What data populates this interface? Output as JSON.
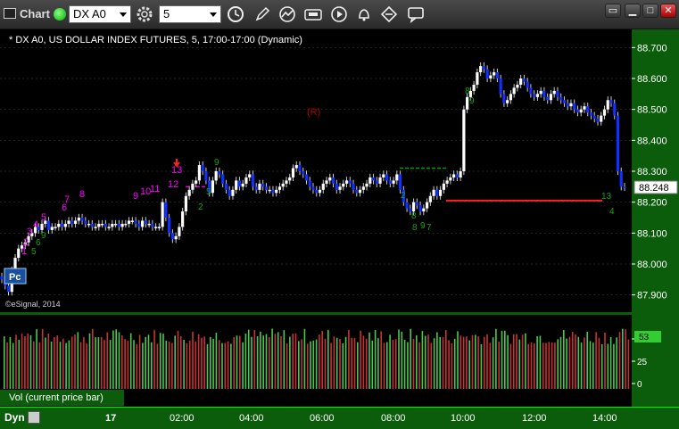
{
  "window": {
    "title": "Chart"
  },
  "toolbar": {
    "symbol_value": "DX A0",
    "interval_value": "5"
  },
  "chart": {
    "header_text": "* DX A0, US DOLLAR INDEX FUTURES, 5, 17:00-17:00 (Dynamic)",
    "copyright": "©eSignal, 2014",
    "annotation_r": "(R)",
    "pc_label": "Pc",
    "price_ticks": [
      "88.700",
      "88.600",
      "88.500",
      "88.400",
      "88.300",
      "88.200",
      "88.100",
      "88.000",
      "87.900"
    ],
    "last_price": "88.248",
    "seq_magenta": [
      "1",
      "2",
      "3",
      "4",
      "5",
      "6",
      "7",
      "8",
      "9",
      "10",
      "11",
      "12",
      "13"
    ],
    "seq_green_a": [
      "5",
      "6",
      "9"
    ],
    "seq_green_b": [
      "2",
      "5",
      "9"
    ],
    "seq_green_c": [
      "2",
      "8",
      "9",
      "8",
      "7"
    ],
    "seq_green_d": [
      "8",
      "9"
    ],
    "seq_green_e": [
      "13",
      "4"
    ]
  },
  "volume": {
    "title": "Vol (current price bar)",
    "ticks": [
      "50",
      "25",
      "0"
    ],
    "current_value": "53"
  },
  "timeaxis": {
    "mode_label": "Dyn",
    "labels": [
      "17",
      "02:00",
      "04:00",
      "06:00",
      "08:00",
      "10:00",
      "12:00",
      "14:00"
    ]
  },
  "chart_data": {
    "type": "candlestick",
    "symbol": "DX A0",
    "interval": "5",
    "ylim": [
      87.85,
      88.75
    ],
    "price_ticks": [
      88.7,
      88.6,
      88.5,
      88.4,
      88.3,
      88.2,
      88.1,
      88.0,
      87.9
    ],
    "last_price": 88.248,
    "close_series": [
      87.95,
      87.93,
      87.91,
      87.98,
      88.02,
      88.05,
      88.06,
      88.07,
      88.09,
      88.1,
      88.12,
      88.11,
      88.13,
      88.14,
      88.11,
      88.12,
      88.12,
      88.13,
      88.12,
      88.13,
      88.14,
      88.13,
      88.14,
      88.15,
      88.14,
      88.13,
      88.13,
      88.12,
      88.12,
      88.13,
      88.13,
      88.12,
      88.12,
      88.13,
      88.13,
      88.12,
      88.13,
      88.13,
      88.14,
      88.14,
      88.13,
      88.12,
      88.14,
      88.13,
      88.13,
      88.12,
      88.12,
      88.12,
      88.2,
      88.15,
      88.1,
      88.08,
      88.09,
      88.12,
      88.17,
      88.22,
      88.24,
      88.26,
      88.27,
      88.32,
      88.3,
      88.27,
      88.23,
      88.27,
      88.3,
      88.29,
      88.26,
      88.24,
      88.22,
      88.24,
      88.27,
      88.25,
      88.26,
      88.28,
      88.29,
      88.25,
      88.24,
      88.26,
      88.25,
      88.24,
      88.24,
      88.23,
      88.24,
      88.25,
      88.26,
      88.27,
      88.28,
      88.31,
      88.32,
      88.3,
      88.29,
      88.27,
      88.25,
      88.24,
      88.23,
      88.24,
      88.26,
      88.27,
      88.28,
      88.26,
      88.24,
      88.25,
      88.26,
      88.27,
      88.26,
      88.24,
      88.23,
      88.24,
      88.25,
      88.26,
      88.28,
      88.27,
      88.26,
      88.28,
      88.29,
      88.27,
      88.26,
      88.27,
      88.29,
      88.24,
      88.2,
      88.18,
      88.17,
      88.2,
      88.19,
      88.17,
      88.18,
      88.2,
      88.22,
      88.24,
      88.22,
      88.24,
      88.26,
      88.27,
      88.28,
      88.29,
      88.28,
      88.3,
      88.5,
      88.54,
      88.56,
      88.58,
      88.62,
      88.64,
      88.63,
      88.6,
      88.61,
      88.62,
      88.6,
      88.55,
      88.52,
      88.53,
      88.55,
      88.57,
      88.58,
      88.6,
      88.59,
      88.57,
      88.55,
      88.54,
      88.55,
      88.56,
      88.54,
      88.53,
      88.55,
      88.56,
      88.54,
      88.53,
      88.52,
      88.51,
      88.52,
      88.5,
      88.49,
      88.5,
      88.51,
      88.49,
      88.48,
      88.47,
      88.46,
      88.48,
      88.5,
      88.53,
      88.52,
      88.48,
      88.3,
      88.25,
      88.248
    ],
    "levels": [
      {
        "name": "green-dash",
        "value": 88.31,
        "style": "dashed",
        "color": "#00a000"
      },
      {
        "name": "magenta-dash",
        "value": 88.25,
        "style": "dashed",
        "color": "#e000e0"
      },
      {
        "name": "red-support",
        "value": 88.205,
        "style": "solid",
        "color": "#ff2020"
      }
    ],
    "volume_ylim": [
      0,
      60
    ],
    "volume_ticks": [
      50,
      25,
      0
    ],
    "volume_current": 53,
    "time_labels": [
      "17",
      "02:00",
      "04:00",
      "06:00",
      "08:00",
      "10:00",
      "12:00",
      "14:00"
    ],
    "colors": {
      "up": "#ffffff",
      "down": "#1030ff",
      "vol_up": "#4cc84c",
      "vol_down": "#c83232",
      "axis_bg": "#0b5c0b"
    }
  }
}
